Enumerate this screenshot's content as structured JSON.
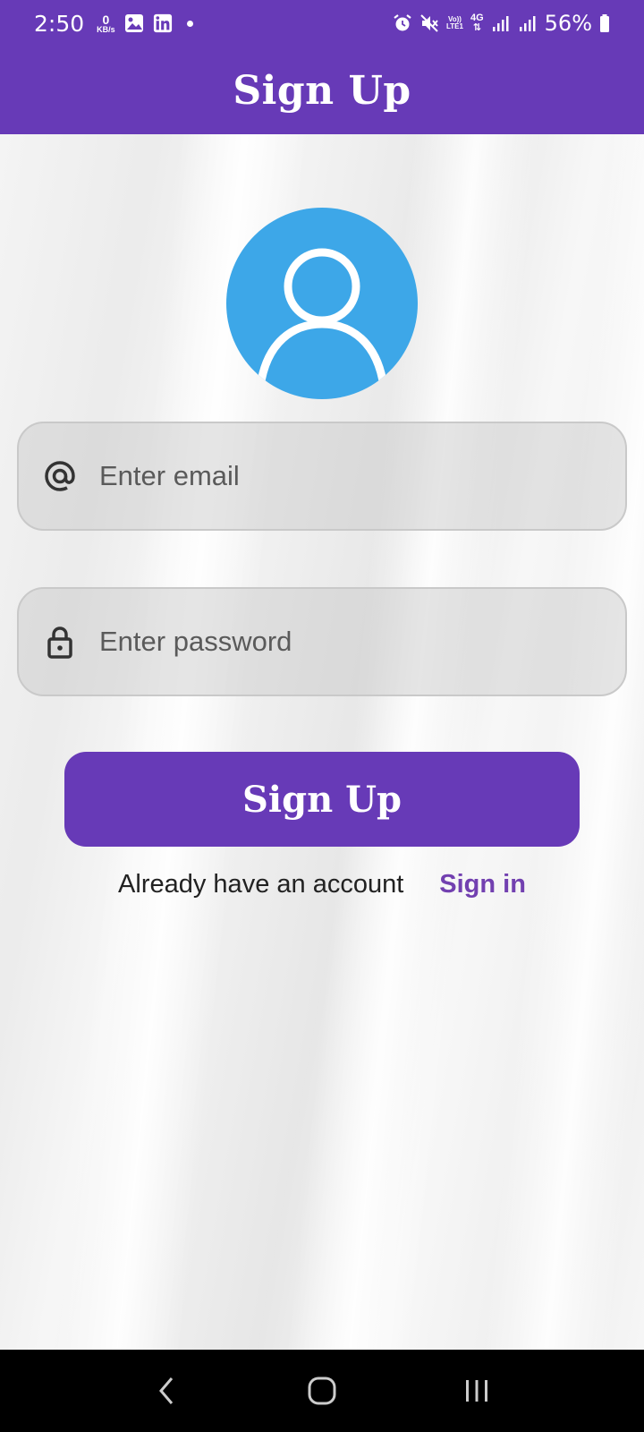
{
  "status_bar": {
    "time": "2:50",
    "data_rate_value": "0",
    "data_rate_unit": "KB/s",
    "network_vo": "Vo))",
    "network_lte": "LTE1",
    "network_type": "4G",
    "battery": "56%",
    "icons": [
      "gallery-icon",
      "linkedin-icon",
      "alarm-icon",
      "mute-icon",
      "signal-icon",
      "battery-icon"
    ]
  },
  "app_bar": {
    "title": "Sign Up"
  },
  "avatar": {
    "icon": "user-avatar-icon",
    "color": "#3da7e8"
  },
  "email_field": {
    "placeholder": "Enter email",
    "value": "",
    "icon": "at-sign-icon"
  },
  "password_field": {
    "placeholder": "Enter password",
    "value": "",
    "icon": "lock-icon"
  },
  "signup_button": {
    "label": "Sign Up"
  },
  "account_prompt": {
    "text": "Already have an account",
    "link": "Sign in"
  },
  "colors": {
    "primary": "#673ab7",
    "link": "#7240b0"
  },
  "nav_bar": {
    "icons": [
      "back-icon",
      "home-icon",
      "recents-icon"
    ]
  }
}
